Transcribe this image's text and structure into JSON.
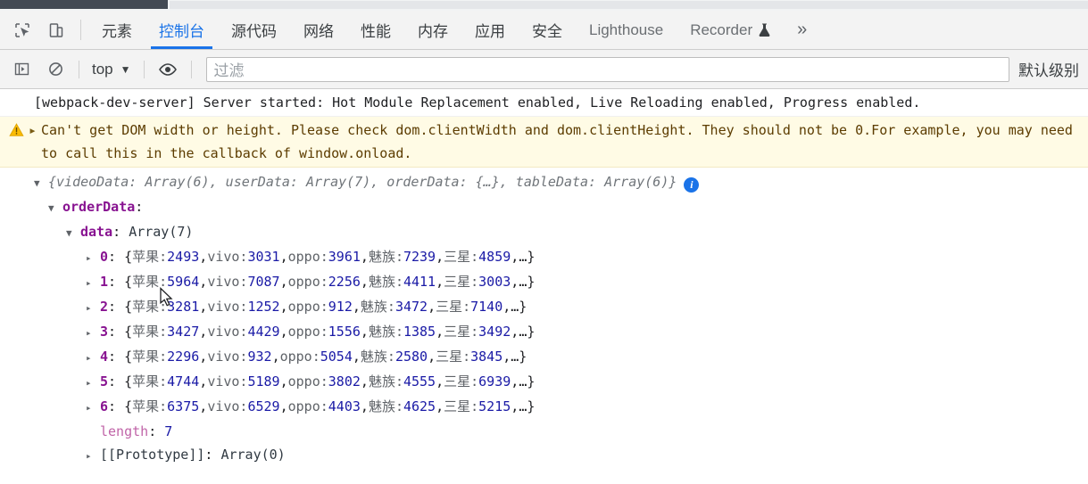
{
  "tabbar": {
    "icons": [
      {
        "name": "inspect-element-icon",
        "label": "Inspect element"
      },
      {
        "name": "device-toolbar-icon",
        "label": "Toggle device toolbar"
      }
    ],
    "tabs": [
      {
        "label": "元素",
        "active": false,
        "latin": false
      },
      {
        "label": "控制台",
        "active": true,
        "latin": false
      },
      {
        "label": "源代码",
        "active": false,
        "latin": false
      },
      {
        "label": "网络",
        "active": false,
        "latin": false
      },
      {
        "label": "性能",
        "active": false,
        "latin": false
      },
      {
        "label": "内存",
        "active": false,
        "latin": false
      },
      {
        "label": "应用",
        "active": false,
        "latin": false
      },
      {
        "label": "安全",
        "active": false,
        "latin": false
      },
      {
        "label": "Lighthouse",
        "active": false,
        "latin": true
      },
      {
        "label": "Recorder",
        "active": false,
        "latin": true,
        "icon": "flask-icon"
      }
    ],
    "more_label": "»"
  },
  "toolbar": {
    "sidebar_toggle": "console-sidebar-icon",
    "clear_console": "clear-console-icon",
    "context": "top",
    "context_caret": "▼",
    "eye_icon": "live-expression-eye-icon",
    "filter_placeholder": "过滤",
    "filter_value": "",
    "levels_label": "默认级别"
  },
  "console": {
    "messages": [
      {
        "type": "log",
        "text": "[webpack-dev-server] Server started: Hot Module Replacement enabled, Live Reloading enabled, Progress enabled."
      },
      {
        "type": "warning",
        "icon": "warning-triangle-icon",
        "arrow": "▸",
        "text": "Can't get DOM width or height. Please check dom.clientWidth and dom.clientHeight. They should not be 0.For example, you may need to call this in the callback of window.onload."
      }
    ],
    "object": {
      "root_arrow": "▼",
      "root_preview": "{videoData: Array(6), userData: Array(7), orderData: {…}, tableData: Array(6)}",
      "info_badge": "i",
      "order_data_arrow": "▼",
      "order_data_key": "orderData",
      "data_arrow": "▼",
      "data_key": "data",
      "data_value": "Array(7)",
      "item_arrow": "▸",
      "keys": [
        "苹果",
        "vivo",
        "oppo",
        "魅族",
        "三星"
      ],
      "items": [
        {
          "index": "0",
          "values": [
            2493,
            3031,
            3961,
            7239,
            4859
          ]
        },
        {
          "index": "1",
          "values": [
            5964,
            7087,
            2256,
            4411,
            3003
          ]
        },
        {
          "index": "2",
          "values": [
            3281,
            1252,
            912,
            3472,
            7140
          ]
        },
        {
          "index": "3",
          "values": [
            3427,
            4429,
            1556,
            1385,
            3492
          ]
        },
        {
          "index": "4",
          "values": [
            2296,
            932,
            5054,
            2580,
            3845
          ]
        },
        {
          "index": "5",
          "values": [
            4744,
            5189,
            3802,
            4555,
            6939
          ]
        },
        {
          "index": "6",
          "values": [
            6375,
            6529,
            4403,
            4625,
            5215
          ]
        }
      ],
      "ellipsis": "…",
      "length_key": "length",
      "length_value": "7",
      "prototype_arrow": "▸",
      "prototype_key": "[[Prototype]]",
      "prototype_value": "Array(0)"
    }
  },
  "colors": {
    "accent": "#1a73e8",
    "warning_bg": "#fffbe5",
    "property": "#881391",
    "number": "#1a1aa6",
    "dim": "#5f6368"
  }
}
